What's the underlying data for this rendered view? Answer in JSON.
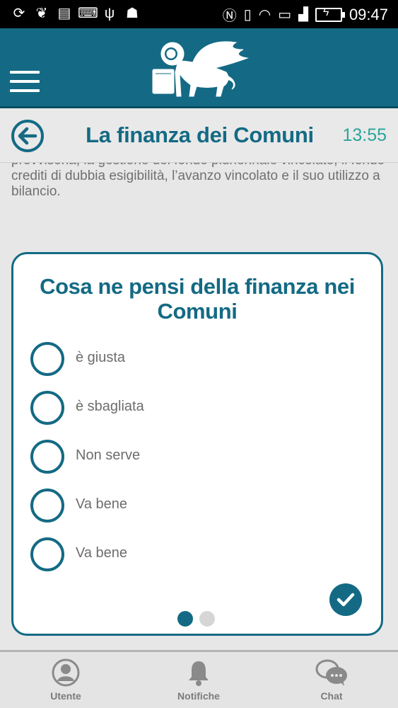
{
  "status_bar": {
    "time": "09:47",
    "icons": [
      "sync-icon",
      "leaf-icon",
      "image-icon",
      "code-icon",
      "usb-icon",
      "android-icon",
      "nfc-icon",
      "vibrate-icon",
      "wifi-icon",
      "sim-icon",
      "signal-icon",
      "battery-charging-icon"
    ]
  },
  "header": {
    "menu_icon": "hamburger-icon",
    "logo": "winged-lion-logo"
  },
  "title_bar": {
    "title": "La finanza dei Comuni",
    "timer": "13:55",
    "back_icon": "back-arrow-icon"
  },
  "content": {
    "text_partial_line": "provvisoria, la gestione del fondo pluriennale vincolato, il fondo",
    "text_line_1": "crediti di dubbia esigibilità, l’avanzo vincolato e il suo utilizzo a",
    "text_line_2": "bilancio."
  },
  "survey": {
    "question": "Cosa ne pensi della finanza nei Comuni",
    "options": [
      {
        "label": "è giusta"
      },
      {
        "label": "è sbagliata"
      },
      {
        "label": "Non serve"
      },
      {
        "label": "Va bene"
      },
      {
        "label": "Va bene"
      }
    ],
    "pager": {
      "current": 1,
      "total": 2
    },
    "confirm_icon": "check-icon"
  },
  "bottom_nav": {
    "items": [
      {
        "label": "Utente",
        "icon": "user-icon"
      },
      {
        "label": "Notifiche",
        "icon": "bell-icon"
      },
      {
        "label": "Chat",
        "icon": "chat-icon"
      }
    ]
  },
  "colors": {
    "primary": "#146a84",
    "timer": "#29a59a",
    "background": "#e7e7e7"
  }
}
